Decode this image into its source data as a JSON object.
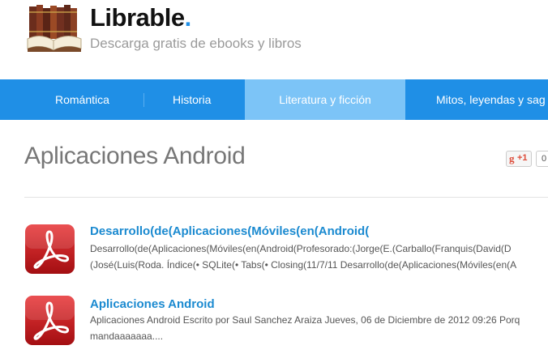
{
  "site": {
    "name": "Librable",
    "name_dot": ".",
    "tagline": "Descarga gratis de ebooks y libros"
  },
  "nav": {
    "items": [
      {
        "label": "Romántica",
        "active": false
      },
      {
        "label": "Historia",
        "active": false
      },
      {
        "label": "Literatura y ficción",
        "active": true
      },
      {
        "label": "Mitos, leyendas y sag",
        "active": false
      }
    ]
  },
  "page": {
    "title": "Aplicaciones Android",
    "gplus_label": "+1",
    "gplus_count": "0"
  },
  "results": [
    {
      "title": "Desarrollo(de(Aplicaciones(Móviles(en(Android(",
      "desc_line1": "Desarrollo(de(Aplicaciones(Móviles(en(Android(Profesorado:(Jorge(E.(Carballo(Franquis(David(D",
      "desc_line2": "(José(Luis(Roda. Índice(• SQLite(• Tabs(• Closing(11/7/11 Desarrollo(de(Aplicaciones(Móviles(en(A"
    },
    {
      "title": "Aplicaciones Android",
      "desc_line1": "Aplicaciones Android Escrito por Saul Sanchez Araiza Jueves, 06 de Diciembre de 2012 09:26 Porq",
      "desc_line2": "mandaaaaaaa...."
    }
  ],
  "colors": {
    "nav_bg": "#1f8fe6",
    "nav_active": "#7cc4f7",
    "link": "#1b8ad0",
    "pdf_red": "#c8181b"
  }
}
